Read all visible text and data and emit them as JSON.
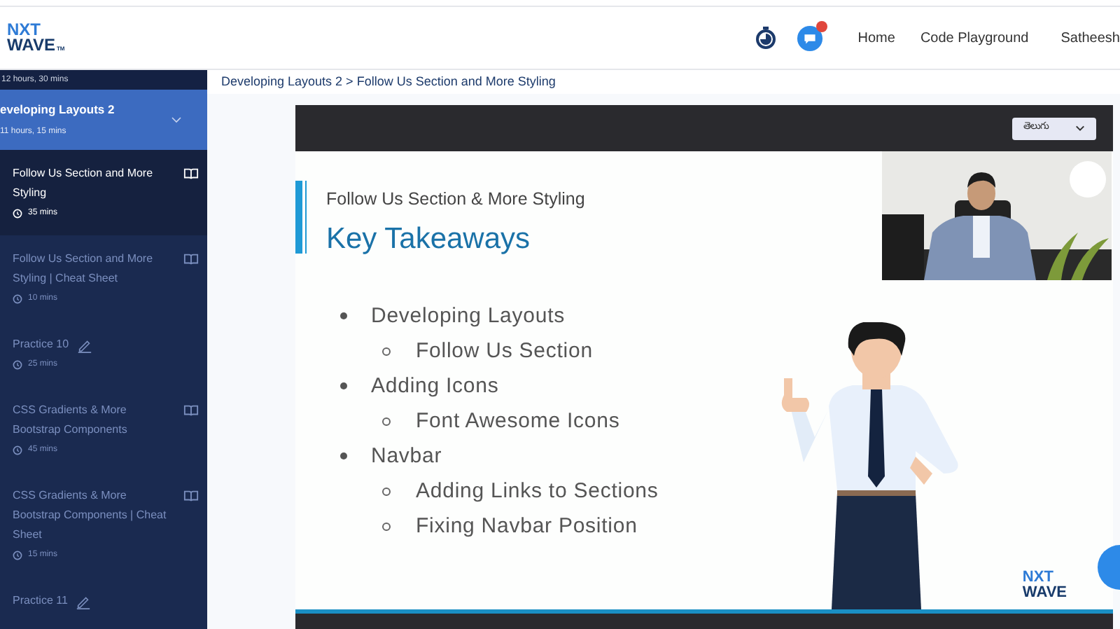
{
  "header": {
    "logo_top": "NXT",
    "logo_bottom": "WAVE",
    "logo_tm": "TM",
    "nav": [
      "Home",
      "Code Playground",
      "Satheesh"
    ]
  },
  "sidebar": {
    "prev_section": {
      "duration": "12 hours, 30 mins"
    },
    "section": {
      "title": "eveloping Layouts 2",
      "duration": "11 hours, 15 mins",
      "expanded": true
    },
    "items": [
      {
        "kind": "reading",
        "title": "Follow Us Section and More Styling",
        "duration": "35 mins",
        "selected": true
      },
      {
        "kind": "reading",
        "title": "Follow Us Section and More Styling | Cheat Sheet",
        "duration": "10 mins",
        "selected": false
      },
      {
        "kind": "practice",
        "title": "Practice 10",
        "duration": "25 mins",
        "selected": false
      },
      {
        "kind": "reading",
        "title": "CSS Gradients & More Bootstrap Components",
        "duration": "45 mins",
        "selected": false
      },
      {
        "kind": "reading",
        "title": "CSS Gradients & More Bootstrap Components | Cheat Sheet",
        "duration": "15 mins",
        "selected": false
      },
      {
        "kind": "practice",
        "title": "Practice 11",
        "selected": false
      }
    ]
  },
  "breadcrumb": "Developing Layouts 2 > Follow Us Section and More Styling",
  "video": {
    "language": "తెలుగు",
    "slide": {
      "subtitle": "Follow Us Section & More Styling",
      "title": "Key Takeaways",
      "bullets": [
        {
          "text": "Developing Layouts",
          "children": [
            {
              "text": "Follow Us Section"
            }
          ]
        },
        {
          "text": "Adding Icons",
          "children": [
            {
              "text": "Font Awesome Icons"
            }
          ]
        },
        {
          "text": "Navbar",
          "children": [
            {
              "text": "Adding Links to Sections"
            },
            {
              "text": "Fixing Navbar Position"
            }
          ]
        }
      ],
      "logo_top": "NXT",
      "logo_bottom": "WAVE"
    }
  }
}
